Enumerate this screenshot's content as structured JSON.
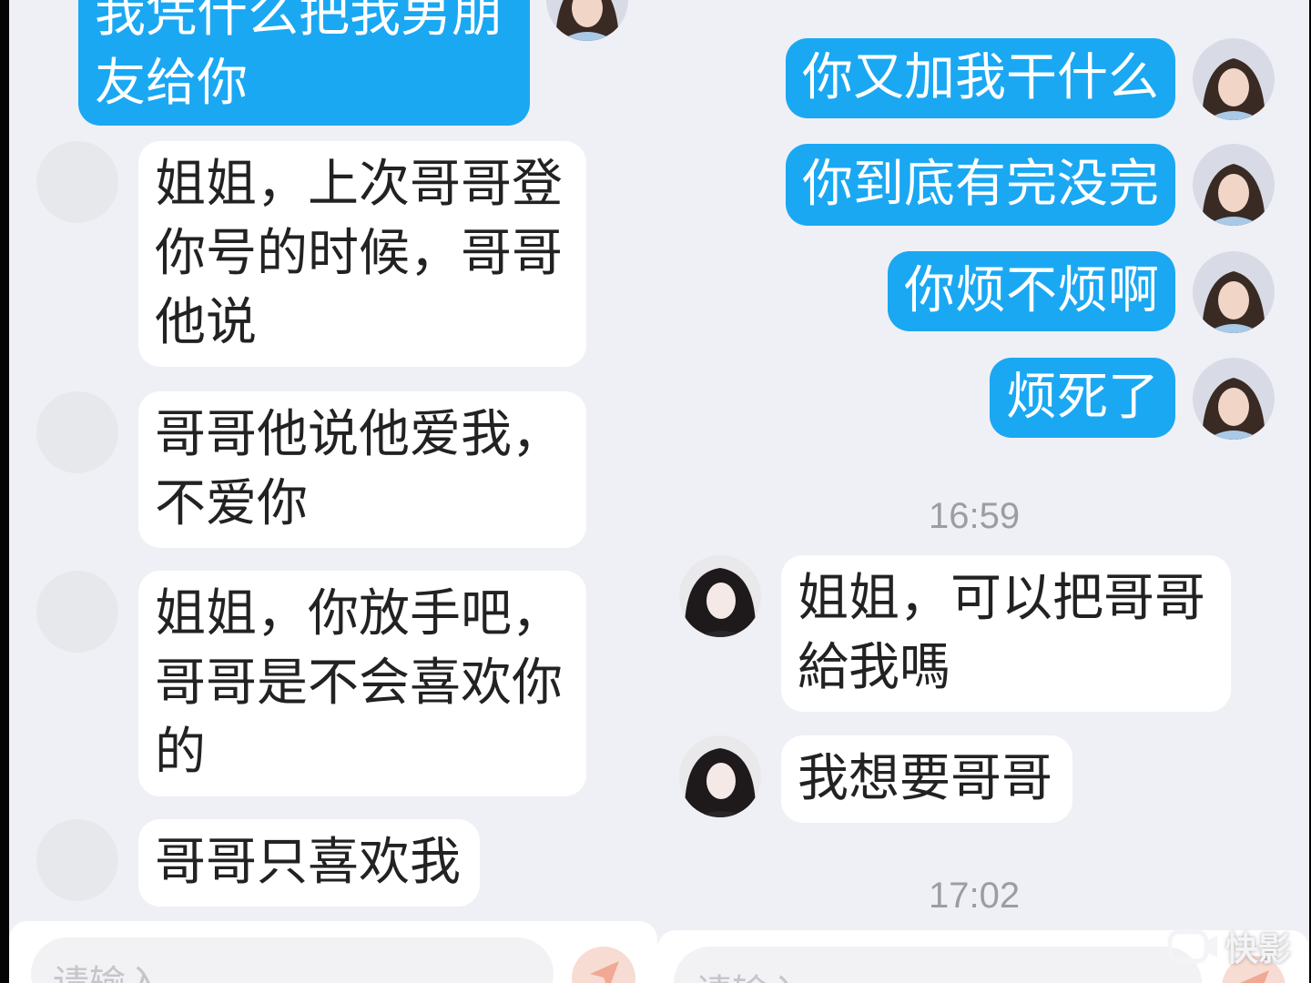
{
  "left_chat": {
    "outgoing_top": "我凭什么把我男朋友给你",
    "incoming": [
      "姐姐，上次哥哥登你号的时候，哥哥他说",
      "哥哥他说他爱我，不爱你",
      "姐姐，你放手吧，哥哥是不会喜欢你的",
      "哥哥只喜欢我"
    ],
    "input_placeholder": "请输入"
  },
  "right_chat": {
    "outgoing": [
      "你又加我干什么",
      "你到底有完没完",
      "你烦不烦啊",
      "烦死了"
    ],
    "time_1": "16:59",
    "incoming": [
      "姐姐，可以把哥哥給我嗎",
      "我想要哥哥"
    ],
    "time_2": "17:02",
    "input_placeholder": "请输入"
  },
  "watermark": {
    "text": "快影",
    "icon": "kuaiying-camera-icon"
  },
  "colors": {
    "outgoing_bubble": "#1aa8f3",
    "incoming_bubble": "#ffffff",
    "chat_background": "#eff0f5",
    "timestamp": "#9c9ca4"
  }
}
